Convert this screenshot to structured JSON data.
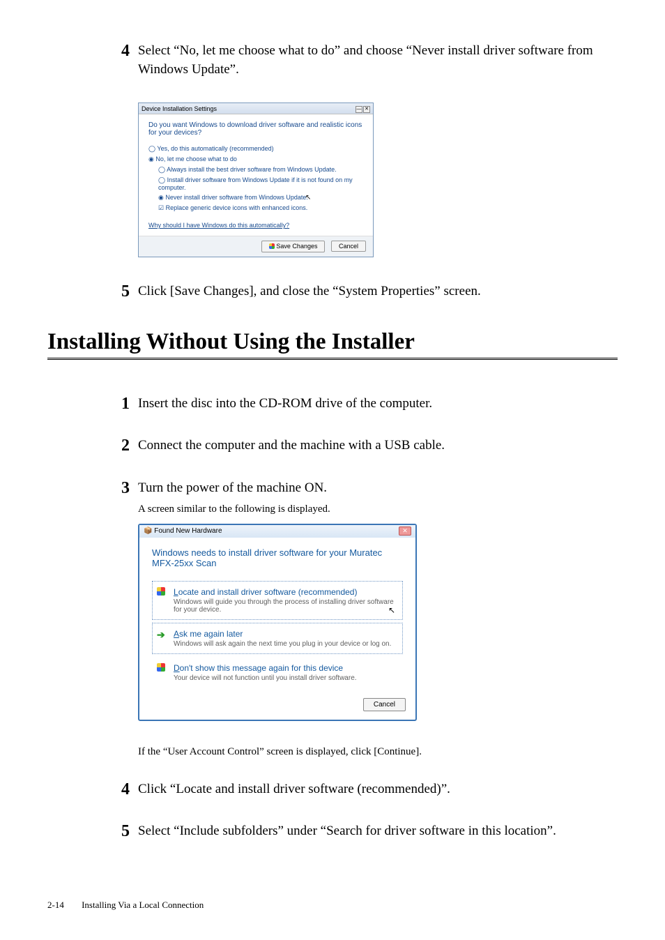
{
  "step4": {
    "num": "4",
    "text": "Select “No, let me choose what to do” and choose “Never install driver software from Windows Update”."
  },
  "dlg1": {
    "title": "Device Installation Settings",
    "prompt": "Do you want Windows to download driver software and realistic icons for your devices?",
    "opt_yes": "Yes, do this automatically (recommended)",
    "opt_no": "No, let me choose what to do",
    "sub_always": "Always install the best driver software from Windows Update.",
    "sub_install": "Install driver software from Windows Update if it is not found on my computer.",
    "sub_never": "Never install driver software from Windows Update.",
    "sub_replace": "Replace generic device icons with enhanced icons.",
    "link": "Why should I have Windows do this automatically?",
    "save": "Save Changes",
    "cancel": "Cancel"
  },
  "step5": {
    "num": "5",
    "text": "Click [Save Changes], and close the “System Properties” screen."
  },
  "h1": "Installing Without Using the Installer",
  "s1": {
    "num": "1",
    "text": "Insert the disc into the CD-ROM drive of the computer."
  },
  "s2": {
    "num": "2",
    "text": "Connect the computer and the machine with a USB cable."
  },
  "s3": {
    "num": "3",
    "text": "Turn the power of the machine ON.",
    "sub": "A screen similar to the following is displayed."
  },
  "dlg2": {
    "title": "Found New Hardware",
    "heading": "Windows needs to install driver software for your Muratec MFX-25xx Scan",
    "opt1_title_pre": "L",
    "opt1_title_rest": "ocate and install driver software (recommended)",
    "opt1_desc": "Windows will guide you through the process of installing driver software for your device.",
    "opt2_title_pre": "A",
    "opt2_title_rest": "sk me again later",
    "opt2_desc": "Windows will ask again the next time you plug in your device or log on.",
    "opt3_title_pre": "D",
    "opt3_title_rest": "on't show this message again for this device",
    "opt3_desc": "Your device will not function until you install driver software.",
    "cancel": "Cancel"
  },
  "after_dlg2": "If the “User Account Control” screen is displayed, click [Continue].",
  "s4": {
    "num": "4",
    "text": " Click “Locate and install driver software (recommended)”."
  },
  "s5": {
    "num": "5",
    "text": "Select “Include subfolders” under “Search for driver software in this location”."
  },
  "footer": {
    "page": "2-14",
    "title": "Installing Via a Local Connection"
  }
}
